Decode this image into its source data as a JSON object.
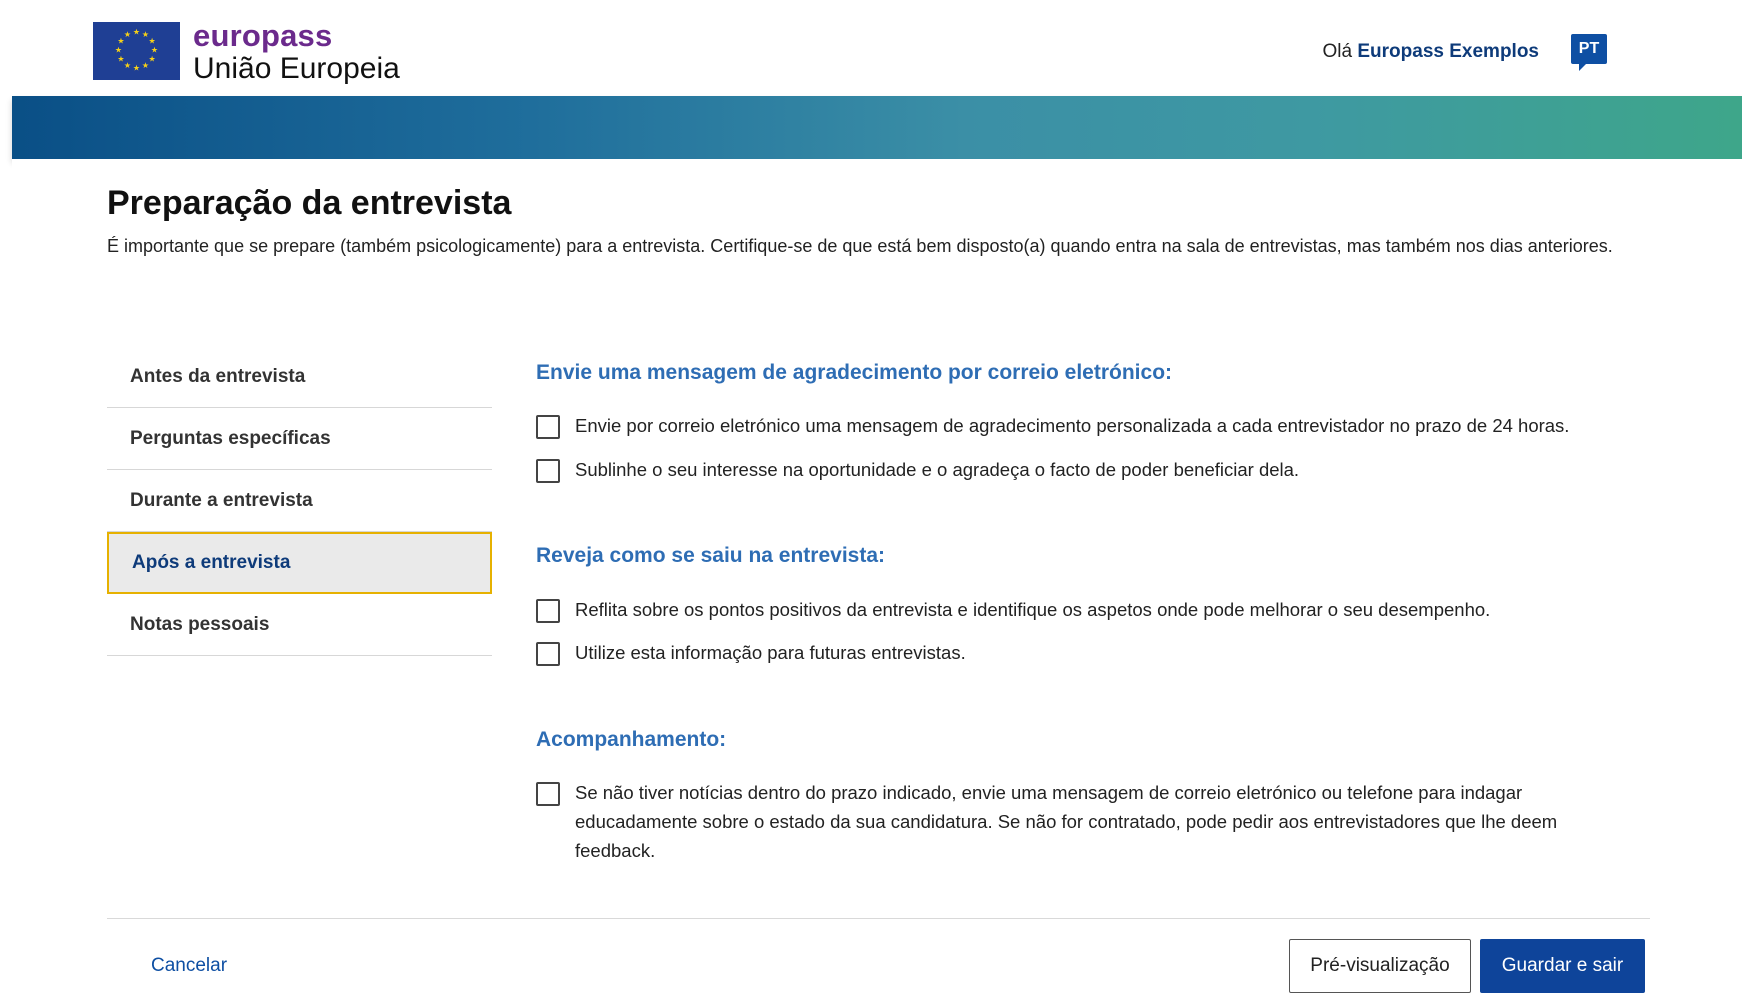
{
  "header": {
    "brand": "europass",
    "brand_sub": "União Europeia",
    "greeting_prefix": "Olá",
    "user_name": "Europass Exemplos",
    "language": "PT"
  },
  "page": {
    "title": "Preparação da entrevista",
    "intro": "É importante que se prepare (também psicologicamente) para a entrevista. Certifique-se de que está bem disposto(a) quando entra na sala de entrevistas, mas também nos dias anteriores."
  },
  "sidebar": {
    "items": [
      {
        "label": "Antes da entrevista",
        "active": false
      },
      {
        "label": "Perguntas específicas",
        "active": false
      },
      {
        "label": "Durante a entrevista",
        "active": false
      },
      {
        "label": "Após a entrevista",
        "active": true
      },
      {
        "label": "Notas pessoais",
        "active": false
      }
    ]
  },
  "sections": [
    {
      "title": "Envie uma mensagem de agradecimento por correio eletrónico:",
      "items": [
        {
          "text": "Envie por correio eletrónico uma mensagem de agradecimento personalizada a cada entrevistador no prazo de 24 horas.",
          "checked": false
        },
        {
          "text": "Sublinhe o seu interesse na oportunidade e o agradeça o facto de poder beneficiar dela.",
          "checked": false
        }
      ]
    },
    {
      "title": "Reveja como se saiu na entrevista:",
      "items": [
        {
          "text": "Reflita sobre os pontos positivos da entrevista e identifique os aspetos onde pode melhorar o seu desempenho.",
          "checked": false
        },
        {
          "text": "Utilize esta informação para futuras entrevistas.",
          "checked": false
        }
      ]
    },
    {
      "title": "Acompanhamento:",
      "items": [
        {
          "text": "Se não tiver notícias dentro do prazo indicado, envie uma mensagem de correio eletrónico ou telefone para indagar educadamente sobre o estado da sua candidatura. Se não for contratado, pode pedir aos entrevistadores que lhe deem feedback.",
          "checked": false
        }
      ]
    }
  ],
  "footer": {
    "cancel_label": "Cancelar",
    "preview_label": "Pré-visualização",
    "save_label": "Guardar e sair"
  },
  "colors": {
    "brand_purple": "#6b2a8c",
    "eu_blue": "#1f3f94",
    "section_title_blue": "#2e6db4",
    "primary_button": "#0e449a",
    "active_border": "#e6b100"
  }
}
